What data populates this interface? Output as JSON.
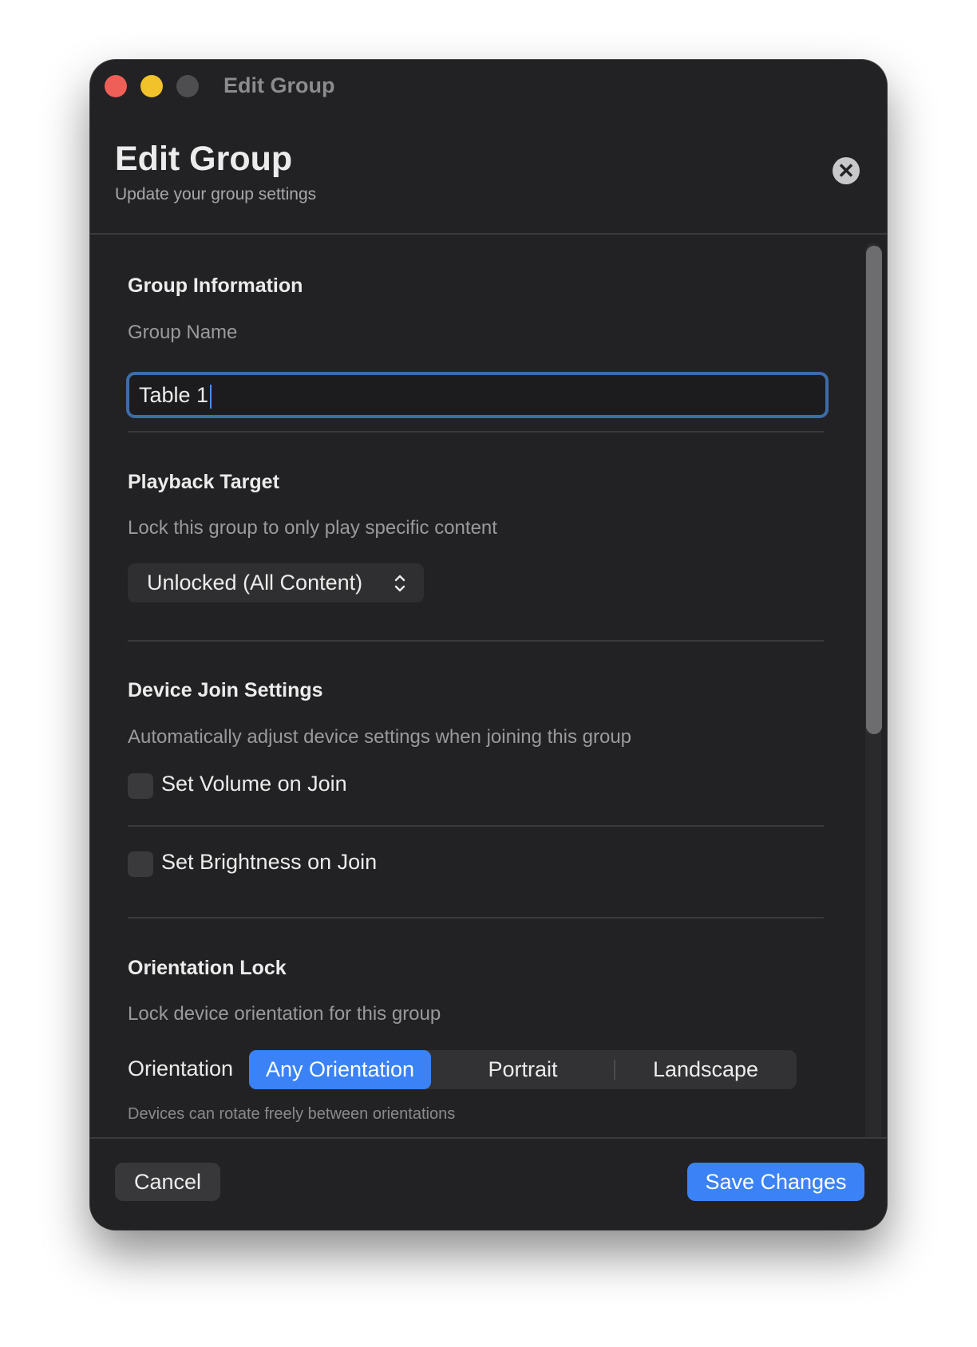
{
  "window": {
    "title": "Edit Group"
  },
  "header": {
    "title": "Edit Group",
    "subtitle": "Update your group settings",
    "close_icon": "close-icon"
  },
  "group_info": {
    "title": "Group Information",
    "name_label": "Group Name",
    "name_value": "Table 1"
  },
  "playback": {
    "title": "Playback Target",
    "description": "Lock this group to only play specific content",
    "selected": "Unlocked (All Content)"
  },
  "device_join": {
    "title": "Device Join Settings",
    "description": "Automatically adjust device settings when joining this group",
    "volume_label": "Set Volume on Join",
    "volume_checked": false,
    "brightness_label": "Set Brightness on Join",
    "brightness_checked": false
  },
  "orientation": {
    "title": "Orientation Lock",
    "description": "Lock device orientation for this group",
    "label": "Orientation",
    "options": [
      "Any Orientation",
      "Portrait",
      "Landscape"
    ],
    "selected": "Any Orientation",
    "help": "Devices can rotate freely between orientations"
  },
  "footer": {
    "cancel": "Cancel",
    "save": "Save Changes"
  },
  "colors": {
    "window_bg": "#222224",
    "accent": "#3b82f6",
    "focus_ring": "#3d6da8",
    "close_red": "#ed5f57",
    "minimize_yellow": "#f1c22a"
  }
}
